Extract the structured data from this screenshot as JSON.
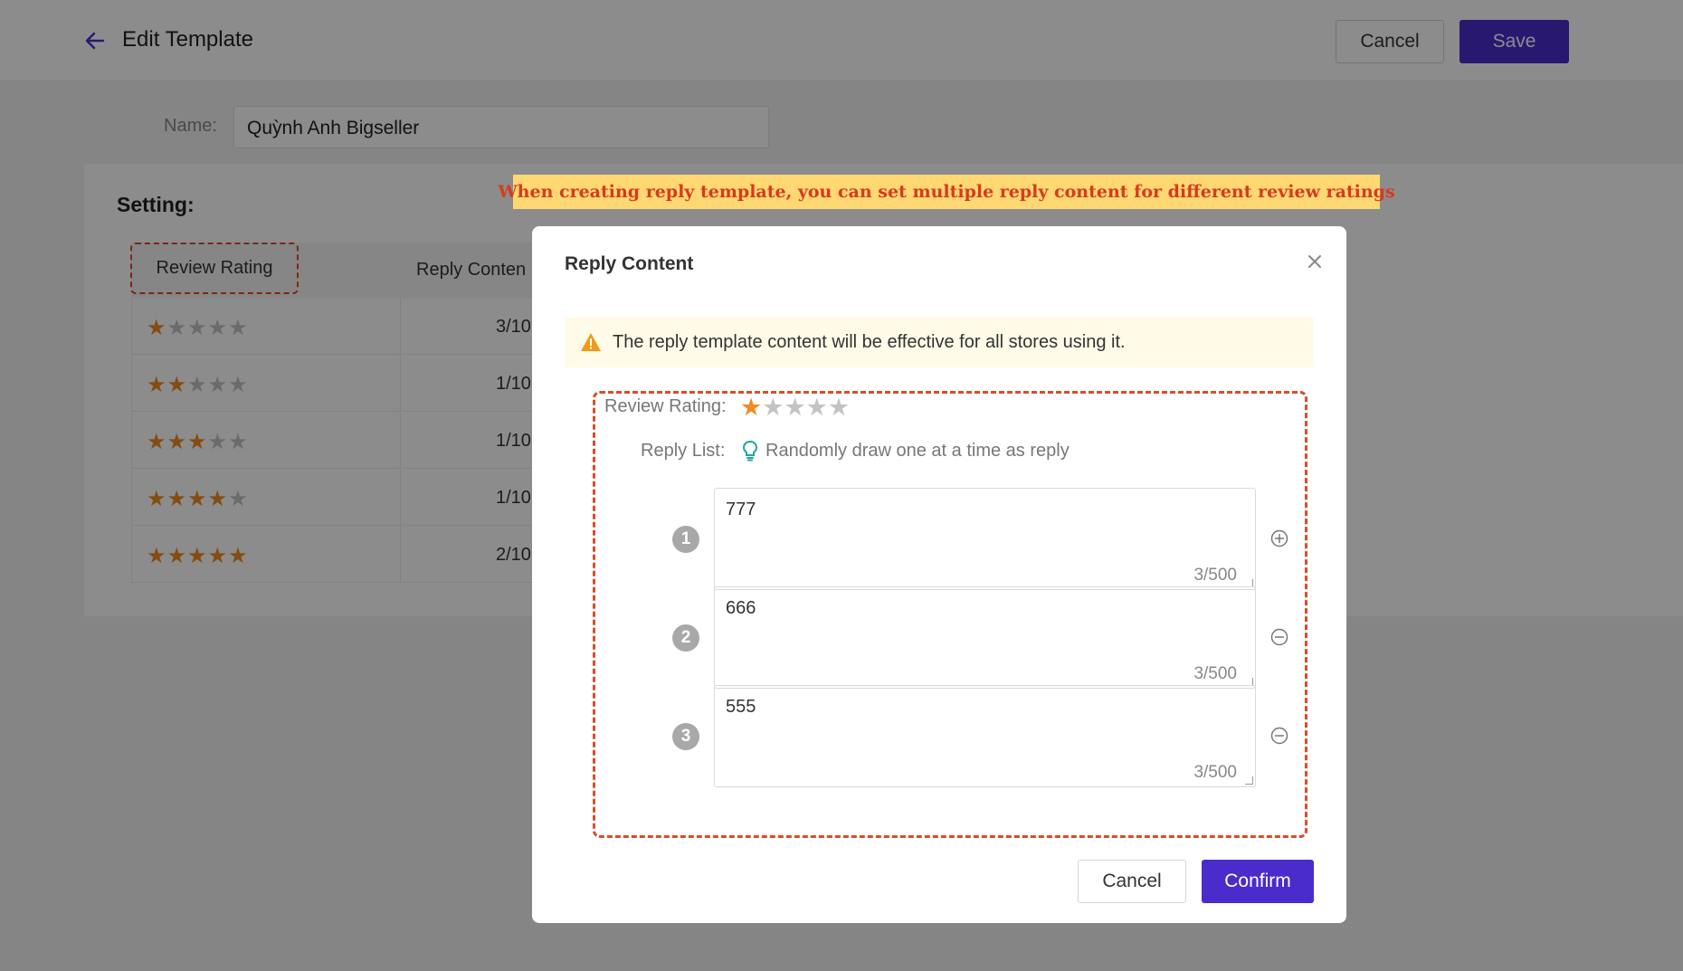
{
  "header": {
    "title": "Edit Template",
    "cancel_label": "Cancel",
    "save_label": "Save"
  },
  "form": {
    "name_label": "Name:",
    "name_value": "Quỳnh Anh Bigseller"
  },
  "setting": {
    "title": "Setting:",
    "hint": "When creating reply template, you can set multiple reply content for different review ratings",
    "columns": [
      "Review Rating",
      "Reply Conten"
    ],
    "rows": [
      {
        "stars": 1,
        "count": "3/10"
      },
      {
        "stars": 2,
        "count": "1/10"
      },
      {
        "stars": 3,
        "count": "1/10"
      },
      {
        "stars": 4,
        "count": "1/10"
      },
      {
        "stars": 5,
        "count": "2/10"
      }
    ]
  },
  "modal": {
    "title": "Reply Content",
    "warning": "The reply template content will be effective for all stores using it.",
    "review_rating_label": "Review Rating:",
    "review_rating_value": 1,
    "reply_list_label": "Reply List:",
    "reply_list_hint": "Randomly draw one at a time as reply",
    "replies": [
      {
        "num": "1",
        "text": "777",
        "counter": "3/500",
        "action": "add"
      },
      {
        "num": "2",
        "text": "666",
        "counter": "3/500",
        "action": "remove"
      },
      {
        "num": "3",
        "text": "555",
        "counter": "3/500",
        "action": "remove"
      }
    ],
    "cancel_label": "Cancel",
    "confirm_label": "Confirm"
  },
  "colors": {
    "primary": "#4a2ccc",
    "star_on": "#f08a24",
    "star_off": "#c3c3c3",
    "highlight_dash": "#e04a2a",
    "hint_bg": "#ffd873"
  }
}
